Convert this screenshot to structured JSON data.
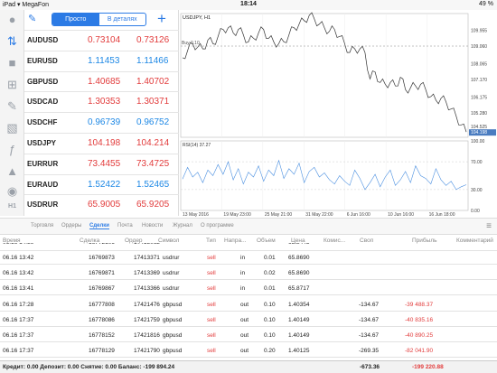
{
  "status_bar": {
    "carrier": "iPad ▾ MegaFon",
    "time": "18:14",
    "battery": "49 %"
  },
  "left_rail": {
    "timeframe_label": "H1"
  },
  "quotes_toolbar": {
    "simple": "Просто",
    "detailed": "В деталях",
    "add": "+"
  },
  "quotes": [
    {
      "symbol": "AUDUSD",
      "bid": "0.73104",
      "ask": "0.73126",
      "color": "#e23b3b"
    },
    {
      "symbol": "EURUSD",
      "bid": "1.11453",
      "ask": "1.11466",
      "color": "#1e88e5"
    },
    {
      "symbol": "GBPUSD",
      "bid": "1.40685",
      "ask": "1.40702",
      "color": "#e23b3b"
    },
    {
      "symbol": "USDCAD",
      "bid": "1.30353",
      "ask": "1.30371",
      "color": "#e23b3b"
    },
    {
      "symbol": "USDCHF",
      "bid": "0.96739",
      "ask": "0.96752",
      "color": "#1e88e5"
    },
    {
      "symbol": "USDJPY",
      "bid": "104.198",
      "ask": "104.214",
      "color": "#e23b3b"
    },
    {
      "symbol": "EURRUR",
      "bid": "73.4455",
      "ask": "73.4725",
      "color": "#e23b3b"
    },
    {
      "symbol": "EURAUD",
      "bid": "1.52422",
      "ask": "1.52465",
      "color": "#1e88e5"
    },
    {
      "symbol": "USDRUR",
      "bid": "65.9005",
      "ask": "65.9205",
      "color": "#e23b3b"
    }
  ],
  "chart_data": {
    "type": "line",
    "title": "USDJPY, H1",
    "buy_label": "Buy 0.10",
    "price_badge": "104.198",
    "ylim": [
      103.9,
      110.9
    ],
    "y_ticks": [
      "109.955",
      "109.060",
      "108.065",
      "107.170",
      "106.175",
      "105.280",
      "104.525",
      "104.198"
    ],
    "x_ticks": [
      "13 May 2016",
      "19 May 16:00",
      "25 May 21:00",
      "31 May 22:00",
      "6 Jun 16:00",
      "10 Jun 16:00",
      "16 Jun 18:00"
    ],
    "x_tick_labels": [
      "13 May 2016",
      "19 May 23:00",
      "25 May 21:00",
      "31 May 22:00",
      "6 Jun 16:00",
      "10 Jun 16:00",
      "16 Jun 18:00"
    ],
    "series": [
      {
        "name": "USDJPY",
        "values": [
          108.4,
          108.8,
          109.2,
          109.0,
          108.9,
          109.4,
          109.2,
          109.6,
          110.0,
          110.1,
          109.8,
          110.0,
          109.7,
          109.3,
          109.5,
          109.8,
          110.0,
          109.5,
          109.3,
          109.2,
          109.3,
          109.7,
          110.1,
          110.3,
          110.5,
          110.8,
          110.6,
          110.3,
          110.1,
          109.9,
          110.0,
          109.6,
          109.2,
          108.7,
          108.9,
          108.9,
          108.7,
          107.2,
          107.6,
          107.0,
          106.9,
          107.0,
          106.8,
          107.3,
          106.6,
          106.7,
          106.8,
          106.9,
          106.6,
          106.2,
          106.0,
          106.1,
          105.9,
          105.5,
          105.1,
          104.6,
          104.2
        ]
      }
    ],
    "indicator": {
      "title": "RSI(14) 37.27",
      "ylim": [
        0,
        100
      ],
      "y_ticks": [
        "100.00",
        "70.00",
        "30.00",
        "0.00"
      ],
      "values": [
        45,
        62,
        48,
        55,
        40,
        58,
        50,
        66,
        52,
        70,
        44,
        60,
        38,
        55,
        48,
        64,
        42,
        58,
        50,
        72,
        46,
        60,
        52,
        68,
        40,
        56,
        62,
        48,
        54,
        44,
        38,
        50,
        42,
        36,
        58,
        46,
        30,
        40,
        52,
        34,
        48,
        58,
        36,
        44,
        56,
        40,
        64,
        50,
        46,
        38,
        60,
        44,
        36,
        42,
        30,
        34,
        37
      ]
    }
  },
  "tabs": {
    "items": [
      "Торговля",
      "Ордеры",
      "Сделки",
      "Почта",
      "Новости",
      "Журнал",
      "О программе"
    ],
    "active_index": 2
  },
  "table": {
    "headers": [
      "Время",
      "Сделка",
      "Ордер",
      "Символ",
      "Тип",
      "Напра...",
      "Объем",
      "Цена",
      "Комис...",
      "Своп",
      "Прибыль",
      "Комментарий"
    ],
    "partial_row": {
      "time": "06.16 14:39",
      "deal": "16772106",
      "order": "17415062",
      "price": "65.8443"
    },
    "rows": [
      {
        "time": "06.16 13:42",
        "deal": "16769873",
        "order": "17413371",
        "symbol": "usdrur",
        "type": "sell",
        "dir": "in",
        "volume": "0.01",
        "price": "65.8690",
        "swap": "",
        "profit": ""
      },
      {
        "time": "06.16 13:42",
        "deal": "16769871",
        "order": "17413369",
        "symbol": "usdrur",
        "type": "sell",
        "dir": "in",
        "volume": "0.02",
        "price": "65.8690",
        "swap": "",
        "profit": ""
      },
      {
        "time": "06.16 13:41",
        "deal": "16769867",
        "order": "17413366",
        "symbol": "usdrur",
        "type": "sell",
        "dir": "in",
        "volume": "0.01",
        "price": "65.8717",
        "swap": "",
        "profit": ""
      },
      {
        "time": "06.16 17:28",
        "deal": "16777808",
        "order": "17421476",
        "symbol": "gbpusd",
        "type": "sell",
        "dir": "out",
        "volume": "0.10",
        "price": "1.40354",
        "swap": "-134.67",
        "profit": "-39 488.37"
      },
      {
        "time": "06.16 17:37",
        "deal": "16778086",
        "order": "17421759",
        "symbol": "gbpusd",
        "type": "sell",
        "dir": "out",
        "volume": "0.10",
        "price": "1.40149",
        "swap": "-134.67",
        "profit": "-40 835.16"
      },
      {
        "time": "06.16 17:37",
        "deal": "16778152",
        "order": "17421816",
        "symbol": "gbpusd",
        "type": "sell",
        "dir": "out",
        "volume": "0.10",
        "price": "1.40149",
        "swap": "-134.67",
        "profit": "-40 890.25"
      },
      {
        "time": "06.16 17:37",
        "deal": "16778129",
        "order": "17421790",
        "symbol": "gbpusd",
        "type": "sell",
        "dir": "out",
        "volume": "0.20",
        "price": "1.40125",
        "swap": "-269.35",
        "profit": "-82 041.90"
      }
    ]
  },
  "footer": {
    "summary": "Кредит: 0.00 Депозит: 0.00 Снятие: 0.00 Баланс: -199 894.24",
    "swap_total": "-673.36",
    "profit_total": "-199 220.88"
  }
}
